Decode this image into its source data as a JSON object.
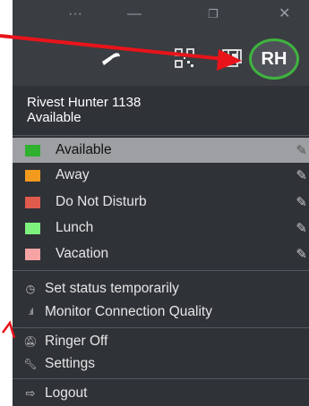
{
  "titlebar": {
    "more_icon": "more-horizontal-icon",
    "minimize_icon": "minimize-icon",
    "maximize_icon": "maximize-icon",
    "close_icon": "close-icon"
  },
  "toolbar": {
    "icons": [
      "phone-icon",
      "dialpad-icon",
      "contacts-icon"
    ],
    "avatar_initials": "RH",
    "avatar_ring_color": "#3fb43f"
  },
  "user": {
    "name_line": "Rivest Hunter 1138",
    "status_line": "Available"
  },
  "statuses": [
    {
      "label": "Available",
      "color": "#2fb02f",
      "selected": true
    },
    {
      "label": "Away",
      "color": "#f39a1e"
    },
    {
      "label": "Do Not Disturb",
      "color": "#e05a4e"
    },
    {
      "label": "Lunch",
      "color": "#7ef07e"
    },
    {
      "label": "Vacation",
      "color": "#f5a3a3"
    }
  ],
  "menu": {
    "set_status_temporarily": "Set status temporarily",
    "monitor_connection_quality": "Monitor Connection Quality",
    "ringer_off": "Ringer Off",
    "settings": "Settings",
    "logout": "Logout"
  },
  "annotations": {
    "arrow_color": "#e8141a"
  }
}
